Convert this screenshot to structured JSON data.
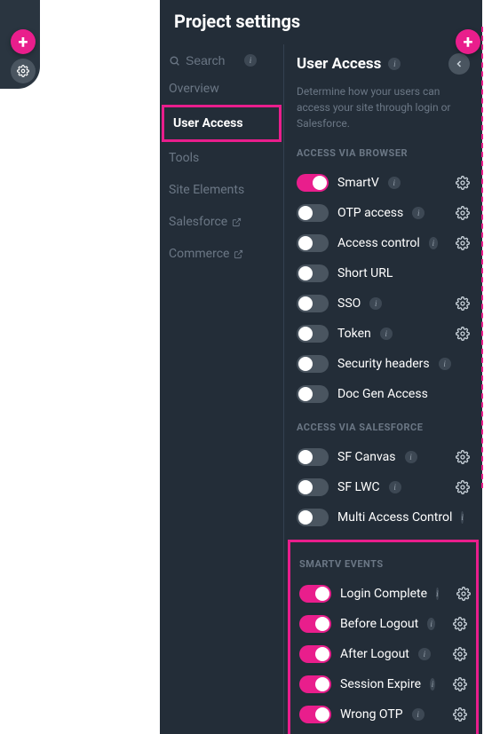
{
  "header": {
    "title": "Project settings"
  },
  "sidebar": {
    "search_placeholder": "Search",
    "items": [
      {
        "label": "Overview",
        "active": false,
        "external": false
      },
      {
        "label": "User Access",
        "active": true,
        "external": false
      },
      {
        "label": "Tools",
        "active": false,
        "external": false
      },
      {
        "label": "Site Elements",
        "active": false,
        "external": false
      },
      {
        "label": "Salesforce",
        "active": false,
        "external": true
      },
      {
        "label": "Commerce",
        "active": false,
        "external": true
      }
    ]
  },
  "content": {
    "title": "User Access",
    "description": "Determine how your users can access your site through login or Salesforce.",
    "sections": [
      {
        "label": "ACCESS VIA BROWSER",
        "items": [
          {
            "label": "SmartV",
            "on": true,
            "info": true,
            "gear": true
          },
          {
            "label": "OTP access",
            "on": false,
            "info": true,
            "gear": true
          },
          {
            "label": "Access control",
            "on": false,
            "info": true,
            "gear": true
          },
          {
            "label": "Short URL",
            "on": false,
            "info": false,
            "gear": false
          },
          {
            "label": "SSO",
            "on": false,
            "info": true,
            "gear": true
          },
          {
            "label": "Token",
            "on": false,
            "info": true,
            "gear": true
          },
          {
            "label": "Security headers",
            "on": false,
            "info": true,
            "gear": false
          },
          {
            "label": "Doc Gen Access",
            "on": false,
            "info": false,
            "gear": false
          }
        ]
      },
      {
        "label": "ACCESS VIA SALESFORCE",
        "items": [
          {
            "label": "SF Canvas",
            "on": false,
            "info": true,
            "gear": true
          },
          {
            "label": "SF LWC",
            "on": false,
            "info": true,
            "gear": true
          },
          {
            "label": "Multi Access Control",
            "on": false,
            "info": true,
            "gear": false
          }
        ]
      },
      {
        "label": "SMARTV EVENTS",
        "highlighted": true,
        "items": [
          {
            "label": "Login Complete",
            "on": true,
            "info": true,
            "gear": true
          },
          {
            "label": "Before Logout",
            "on": true,
            "info": true,
            "gear": true
          },
          {
            "label": "After Logout",
            "on": true,
            "info": true,
            "gear": true
          },
          {
            "label": "Session Expire",
            "on": true,
            "info": true,
            "gear": true
          },
          {
            "label": "Wrong OTP",
            "on": true,
            "info": true,
            "gear": true
          }
        ]
      }
    ]
  }
}
